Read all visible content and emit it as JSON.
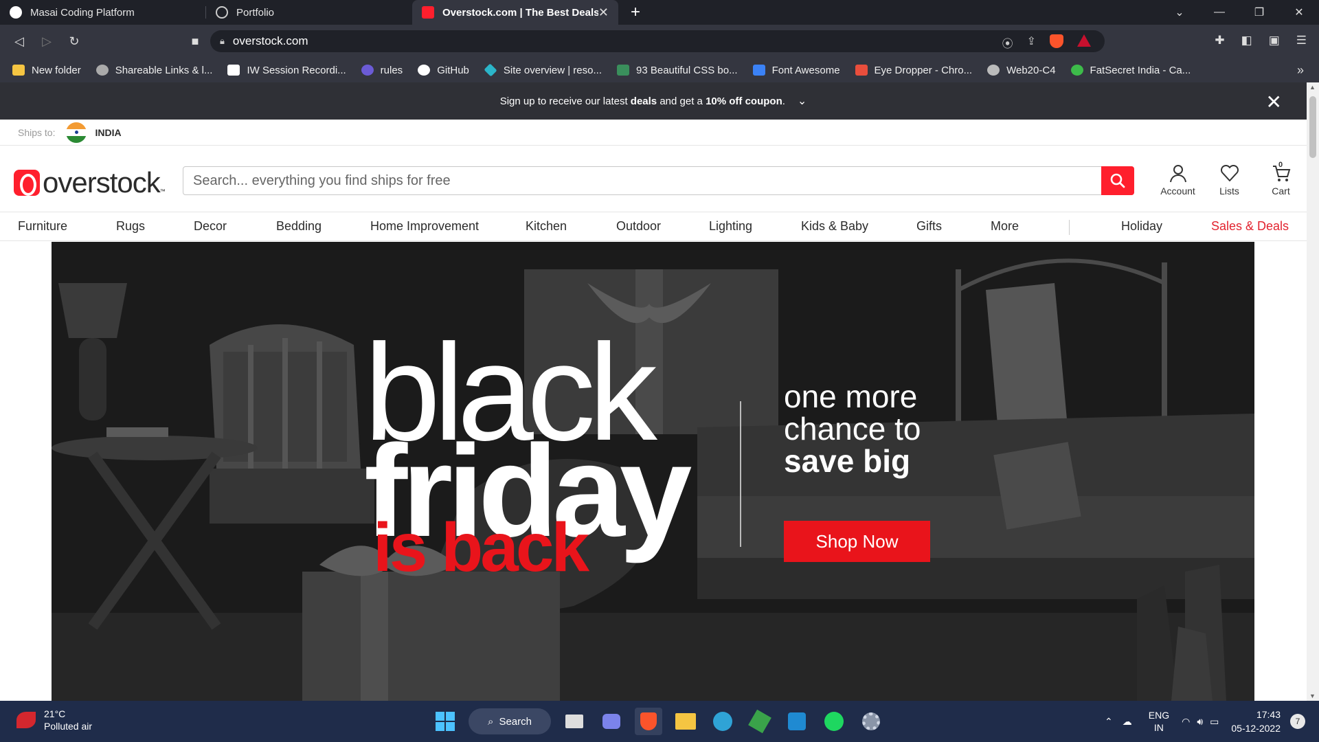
{
  "tabs": [
    {
      "title": "Masai Coding Platform",
      "active": false
    },
    {
      "title": "Portfolio",
      "active": false
    },
    {
      "title": "Overstock.com | The Best Deals O",
      "active": true
    }
  ],
  "toolbar": {
    "url": "overstock.com"
  },
  "bookmarks": [
    {
      "label": "New folder",
      "icon": "folder-icon",
      "color": "#f5c542"
    },
    {
      "label": "Shareable Links & l...",
      "icon": "link-icon",
      "color": "#aaaaaa"
    },
    {
      "label": "IW Session Recordi...",
      "icon": "notion-icon",
      "color": "#ffffff"
    },
    {
      "label": "rules",
      "icon": "rules-icon",
      "color": "#6b5bd6"
    },
    {
      "label": "GitHub",
      "icon": "github-icon",
      "color": "#ffffff"
    },
    {
      "label": "Site overview | reso...",
      "icon": "diamond-icon",
      "color": "#2bb5c9"
    },
    {
      "label": "93 Beautiful CSS bo...",
      "icon": "css-icon",
      "color": "#3a8f5c"
    },
    {
      "label": "Font Awesome",
      "icon": "flag-icon",
      "color": "#3b82f6"
    },
    {
      "label": "Eye Dropper - Chro...",
      "icon": "eyedropper-icon",
      "color": "#e94e3c"
    },
    {
      "label": "Web20-C4",
      "icon": "globe-icon",
      "color": "#bbbbbb"
    },
    {
      "label": "FatSecret India - Ca...",
      "icon": "fatsecret-icon",
      "color": "#3dbb4a"
    }
  ],
  "promo": {
    "pre": "Sign up to receive our latest ",
    "deals": "deals",
    "mid": " and get a ",
    "coupon": "10% off coupon",
    "post": "."
  },
  "ships": {
    "label": "Ships to:",
    "country": "INDIA"
  },
  "logo": {
    "text": "overstock"
  },
  "search": {
    "placeholder": "Search... everything you find ships for free"
  },
  "header_icons": {
    "account": "Account",
    "lists": "Lists",
    "cart": "Cart",
    "cart_count": "0"
  },
  "categories": [
    {
      "label": "Furniture",
      "red": false
    },
    {
      "label": "Rugs",
      "red": false
    },
    {
      "label": "Decor",
      "red": false
    },
    {
      "label": "Bedding",
      "red": false
    },
    {
      "label": "Home Improvement",
      "red": false
    },
    {
      "label": "Kitchen",
      "red": false
    },
    {
      "label": "Outdoor",
      "red": false
    },
    {
      "label": "Lighting",
      "red": false
    },
    {
      "label": "Kids & Baby",
      "red": false
    },
    {
      "label": "Gifts",
      "red": false
    },
    {
      "label": "More",
      "red": false
    },
    {
      "label": "Holiday",
      "red": false
    },
    {
      "label": "Sales & Deals",
      "red": true
    }
  ],
  "hero": {
    "line1": "black",
    "line2": "friday",
    "line3": "is back",
    "tag1": "one more",
    "tag2": "chance to",
    "tag3": "save big",
    "cta": "Shop Now"
  },
  "taskbar": {
    "temp": "21°C",
    "weather": "Polluted air",
    "search": "Search",
    "lang1": "ENG",
    "lang2": "IN",
    "time": "17:43",
    "date": "05-12-2022",
    "notifications": "7"
  }
}
